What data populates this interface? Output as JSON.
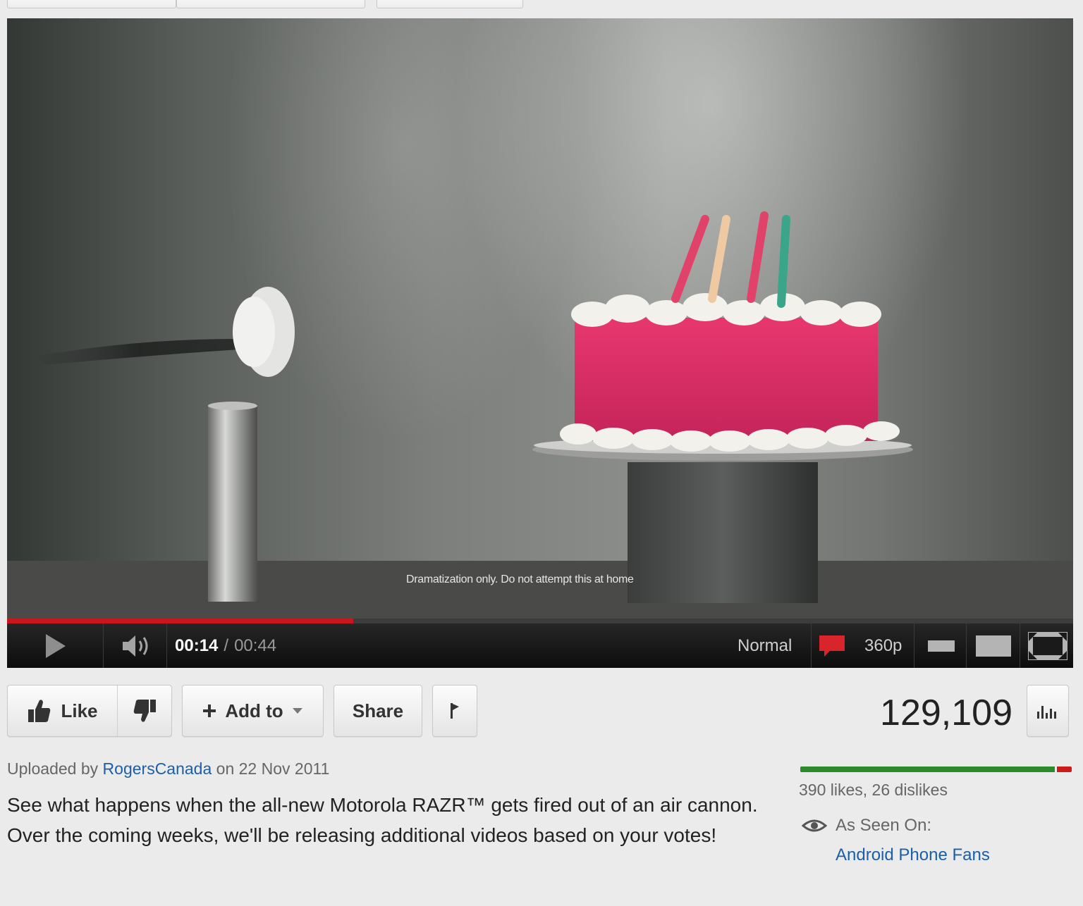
{
  "player": {
    "caption": "Dramatization only. Do not attempt this at home",
    "progress_fraction": 0.325,
    "time_current": "00:14",
    "time_separator": "/",
    "time_total": "00:44",
    "speed_label": "Normal",
    "quality_label": "360p"
  },
  "actions": {
    "like_label": "Like",
    "add_to_label": "Add to",
    "share_label": "Share"
  },
  "stats": {
    "views": "129,109",
    "likes_text": "390 likes, 26 dislikes",
    "like_fraction": 0.9375
  },
  "upload": {
    "prefix": "Uploaded by",
    "uploader": "RogersCanada",
    "on_word": "on",
    "date": "22 Nov 2011"
  },
  "description": "See what happens when the all-new Motorola RAZR™ gets fired out of an air cannon. Over the coming weeks, we'll be releasing additional videos based on your votes!",
  "seen_on": {
    "label": "As Seen On:",
    "site": "Android Phone Fans"
  },
  "colors": {
    "progress": "#c8161d",
    "likes_bar": "#2b8b2b",
    "dislikes_bar": "#cc1b1b",
    "link": "#1b5fa9"
  }
}
